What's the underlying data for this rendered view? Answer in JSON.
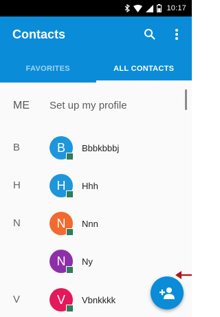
{
  "status_bar": {
    "time": "10:17",
    "icons": [
      "bluetooth-icon",
      "wifi-icon",
      "signal-icon",
      "battery-icon"
    ]
  },
  "app_bar": {
    "title": "Contacts",
    "actions": [
      "search-icon",
      "more-vert-icon"
    ],
    "background_color": "#0a8cd8"
  },
  "tabs": [
    {
      "label": "FAVORITES",
      "selected": false
    },
    {
      "label": "ALL CONTACTS",
      "selected": true
    }
  ],
  "profile_row": {
    "section": "ME",
    "label": "Set up my profile"
  },
  "contacts": [
    {
      "section": "B",
      "initial": "B",
      "name": "Bbbkbbbj",
      "avatar_color": "#1e96dc"
    },
    {
      "section": "H",
      "initial": "H",
      "name": "Hhh",
      "avatar_color": "#1e96dc"
    },
    {
      "section": "N",
      "initial": "N",
      "name": "Nnn",
      "avatar_color": "#f26a2e"
    },
    {
      "section": "",
      "initial": "N",
      "name": "Ny",
      "avatar_color": "#8e2faa"
    },
    {
      "section": "V",
      "initial": "V",
      "name": "Vbnkkkk",
      "avatar_color": "#e4185a"
    }
  ],
  "fab": {
    "icon": "add-contact-icon"
  },
  "annotation": {
    "icon": "arrow-left-icon",
    "color": "#b3131c"
  }
}
